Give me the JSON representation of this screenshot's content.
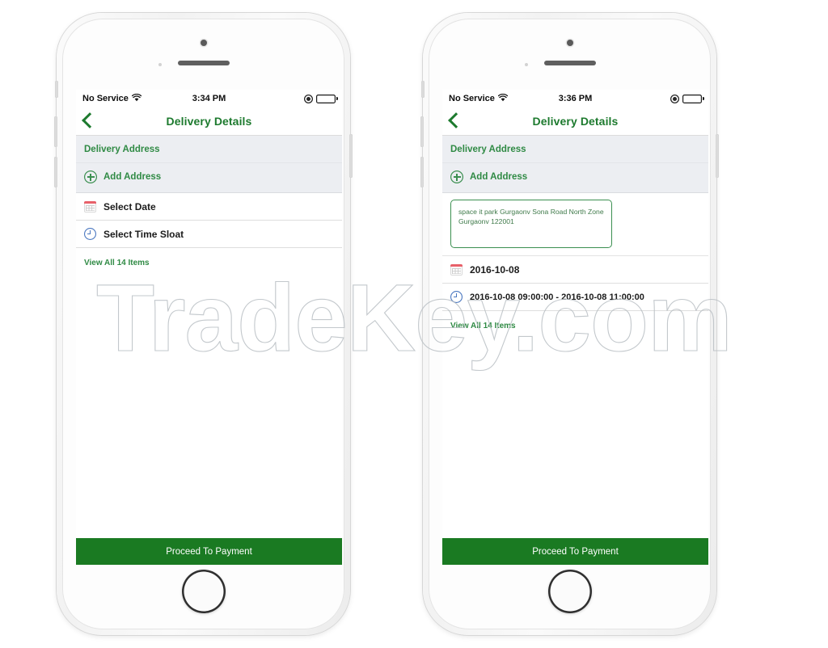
{
  "watermark": {
    "text": "TradeKey.com",
    "color": "#b9bfc4"
  },
  "theme": {
    "brand_green": "#2f8a44",
    "title_green": "#1d7a2e",
    "cta_green": "#1a7a22",
    "section_band": "#eceef2"
  },
  "phones": [
    {
      "id": "left",
      "status_bar": {
        "carrier": "No Service",
        "wifi_icon": "wifi-icon",
        "time": "3:34 PM",
        "rotation_lock_icon": "rotation-lock-icon",
        "battery_icon": "battery-full-icon"
      },
      "nav": {
        "back_icon": "back-chevron-icon",
        "title": "Delivery Details"
      },
      "section": {
        "title": "Delivery Address",
        "add_address_label": "Add Address",
        "add_icon": "plus-circle-icon"
      },
      "address_card": null,
      "rows": [
        {
          "icon": "calendar-icon",
          "label": "Select Date",
          "filled": false
        },
        {
          "icon": "clock-icon",
          "label": "Select Time Sloat",
          "filled": false
        }
      ],
      "view_all_label": "View All 14 Items",
      "cta_label": "Proceed To Payment"
    },
    {
      "id": "right",
      "status_bar": {
        "carrier": "No Service",
        "wifi_icon": "wifi-icon",
        "time": "3:36 PM",
        "rotation_lock_icon": "rotation-lock-icon",
        "battery_icon": "battery-full-icon"
      },
      "nav": {
        "back_icon": "back-chevron-icon",
        "title": "Delivery Details"
      },
      "section": {
        "title": "Delivery Address",
        "add_address_label": "Add Address",
        "add_icon": "plus-circle-icon"
      },
      "address_card": {
        "text": "space it park Gurgaonv Sona Road North Zone Gurgaonv 122001"
      },
      "rows": [
        {
          "icon": "calendar-icon",
          "label": "2016-10-08",
          "filled": true
        },
        {
          "icon": "clock-icon",
          "label": "2016-10-08 09:00:00 - 2016-10-08 11:00:00",
          "filled": true
        }
      ],
      "view_all_label": "View All 14 Items",
      "cta_label": "Proceed To Payment"
    }
  ]
}
